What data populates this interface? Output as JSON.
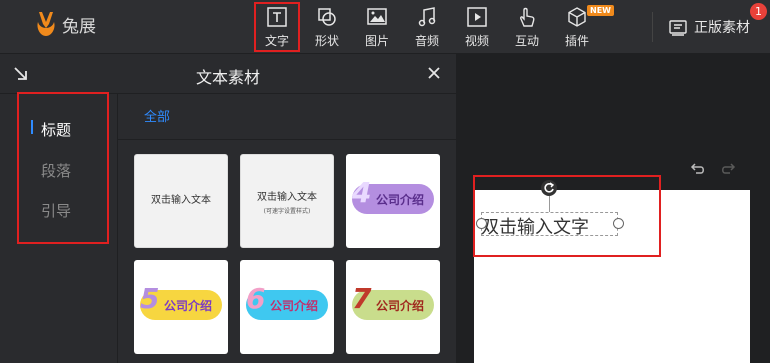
{
  "app": {
    "brand": "兔展"
  },
  "toolbar": {
    "tools": [
      {
        "label": "文字",
        "icon": "text-icon",
        "active": true
      },
      {
        "label": "形状",
        "icon": "shape-icon"
      },
      {
        "label": "图片",
        "icon": "image-icon"
      },
      {
        "label": "音频",
        "icon": "music-note-icon"
      },
      {
        "label": "视频",
        "icon": "video-play-icon"
      },
      {
        "label": "互动",
        "icon": "hand-tap-icon"
      },
      {
        "label": "插件",
        "icon": "cube-icon",
        "badge": "NEW"
      }
    ],
    "copyright": {
      "label": "正版素材",
      "count": "1",
      "icon": "copyright-list-icon"
    }
  },
  "panel": {
    "title": "文本素材",
    "categories": [
      {
        "label": "标题",
        "active": true
      },
      {
        "label": "段落"
      },
      {
        "label": "引导"
      }
    ],
    "filter": "全部",
    "tiles": [
      {
        "line1": "双击输入文本"
      },
      {
        "line1": "双击输入文本",
        "line2": "(可速字设置样式)"
      },
      {
        "num": "4",
        "text": "公司介绍",
        "color": "#b48ee0",
        "num_color": "#e9d9ff"
      },
      {
        "num": "5",
        "text": "公司介绍",
        "color": "#f7d640",
        "num_color": "#b48ee0"
      },
      {
        "num": "6",
        "text": "公司介绍",
        "color": "#3fc8f0",
        "num_color": "#f2a0c8"
      },
      {
        "num": "7",
        "text": "公司介绍",
        "color": "#c9dd8c",
        "num_color": "#c0392b"
      }
    ]
  },
  "canvas": {
    "textbox_text": "双击输入文字"
  }
}
